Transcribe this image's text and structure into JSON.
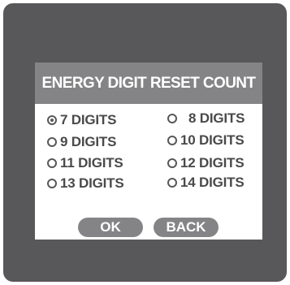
{
  "dialog": {
    "title": "ENERGY DIGIT RESET COUNT"
  },
  "options": [
    {
      "label": "7 DIGITS",
      "selected": true
    },
    {
      "label": "8 DIGITS",
      "selected": false
    },
    {
      "label": "9 DIGITS",
      "selected": false
    },
    {
      "label": "10 DIGITS",
      "selected": false
    },
    {
      "label": "11 DIGITS",
      "selected": false
    },
    {
      "label": "12 DIGITS",
      "selected": false
    },
    {
      "label": "13 DIGITS",
      "selected": false
    },
    {
      "label": "14 DIGITS",
      "selected": false
    }
  ],
  "buttons": {
    "ok_label": "OK",
    "back_label": "BACK"
  },
  "colors": {
    "screen_background": "#58585a",
    "header_background": "#848486",
    "dialog_background": "#ffffff",
    "text": "#4a4a4c"
  },
  "icons": {
    "selected_radio": "radio-selected-icon",
    "unselected_radio": "radio-unselected-icon"
  }
}
